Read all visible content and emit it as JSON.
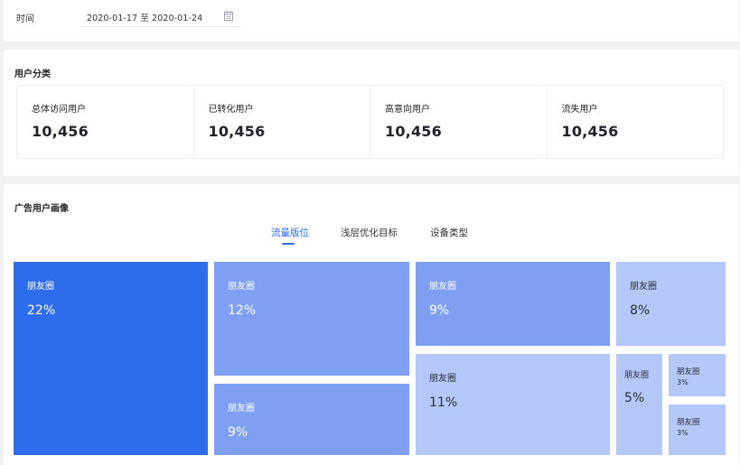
{
  "filter": {
    "time_label": "时间",
    "date_range": "2020-01-17 至 2020-01-24"
  },
  "categories": {
    "title": "用户分类",
    "stats": [
      {
        "label": "总体访问用户",
        "value": "10,456"
      },
      {
        "label": "已转化用户",
        "value": "10,456"
      },
      {
        "label": "高意向用户",
        "value": "10,456"
      },
      {
        "label": "流失用户",
        "value": "10,456"
      }
    ]
  },
  "ad_portrait": {
    "title": "广告用户画像",
    "tabs": [
      {
        "label": "流量版位",
        "active": true
      },
      {
        "label": "浅层优化目标",
        "active": false
      },
      {
        "label": "设备类型",
        "active": false
      }
    ],
    "tiles": [
      {
        "label": "朋友圈",
        "percent": "22%",
        "color": "#2d6ced"
      },
      {
        "label": "朋友圈",
        "percent": "12%",
        "color": "#7e9ff2"
      },
      {
        "label": "朋友圈",
        "percent": "9%",
        "color": "#7e9ff2"
      },
      {
        "label": "朋友圈",
        "percent": "9%",
        "color": "#7e9ff2"
      },
      {
        "label": "朋友圈",
        "percent": "11%",
        "color": "#b4c9f9"
      },
      {
        "label": "朋友圈",
        "percent": "8%",
        "color": "#b4c9f9"
      },
      {
        "label": "朋友圈",
        "percent": "5%",
        "color": "#b4c9f9"
      },
      {
        "label": "朋友圈",
        "percent": "3%",
        "color": "#b4c9f9"
      },
      {
        "label": "朋友圈",
        "percent": "3%",
        "color": "#b4c9f9"
      }
    ]
  }
}
